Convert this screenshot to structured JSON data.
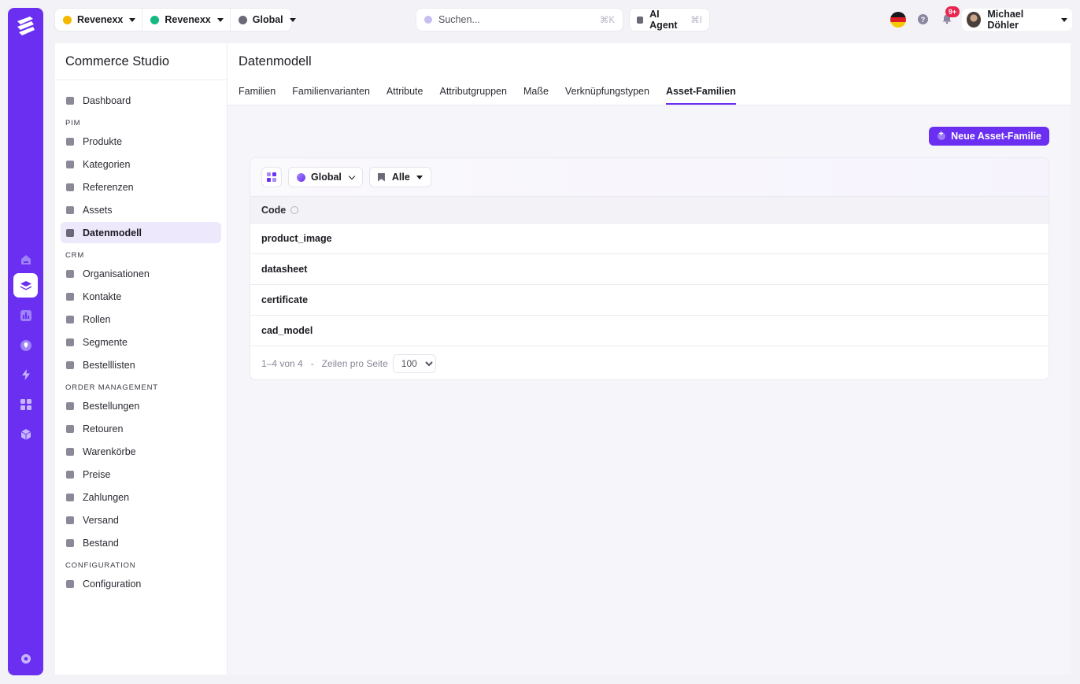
{
  "topbar": {
    "scopes": [
      {
        "label": "Revenexx",
        "dot_color": "#f5b800"
      },
      {
        "label": "Revenexx",
        "dot_color": "#13b981"
      },
      {
        "label": "Global",
        "dot_color": "#6b6877"
      }
    ],
    "search_placeholder": "Suchen...",
    "search_shortcut": "⌘K",
    "ai_agent_label": "AI Agent",
    "ai_agent_shortcut": "⌘I",
    "help_label": "?",
    "notification_badge": "9+",
    "user_name": "Michael Döhler"
  },
  "sidebar": {
    "title": "Commerce Studio",
    "sections": [
      {
        "heading": "",
        "items": [
          {
            "label": "Dashboard",
            "active": false
          }
        ]
      },
      {
        "heading": "PIM",
        "items": [
          {
            "label": "Produkte",
            "active": false
          },
          {
            "label": "Kategorien",
            "active": false
          },
          {
            "label": "Referenzen",
            "active": false
          },
          {
            "label": "Assets",
            "active": false
          },
          {
            "label": "Datenmodell",
            "active": true
          }
        ]
      },
      {
        "heading": "CRM",
        "items": [
          {
            "label": "Organisationen",
            "active": false
          },
          {
            "label": "Kontakte",
            "active": false
          },
          {
            "label": "Rollen",
            "active": false
          },
          {
            "label": "Segmente",
            "active": false
          },
          {
            "label": "Bestelllisten",
            "active": false
          }
        ]
      },
      {
        "heading": "ORDER MANAGEMENT",
        "items": [
          {
            "label": "Bestellungen",
            "active": false
          },
          {
            "label": "Retouren",
            "active": false
          },
          {
            "label": "Warenkörbe",
            "active": false
          },
          {
            "label": "Preise",
            "active": false
          },
          {
            "label": "Zahlungen",
            "active": false
          },
          {
            "label": "Versand",
            "active": false
          },
          {
            "label": "Bestand",
            "active": false
          }
        ]
      },
      {
        "heading": "CONFIGURATION",
        "items": [
          {
            "label": "Configuration",
            "active": false
          }
        ]
      }
    ]
  },
  "main": {
    "title": "Datenmodell",
    "tabs": [
      {
        "label": "Familien",
        "active": false
      },
      {
        "label": "Familienvarianten",
        "active": false
      },
      {
        "label": "Attribute",
        "active": false
      },
      {
        "label": "Attributgruppen",
        "active": false
      },
      {
        "label": "Maße",
        "active": false
      },
      {
        "label": "Verknüpfungstypen",
        "active": false
      },
      {
        "label": "Asset-Familien",
        "active": true
      }
    ],
    "new_button_label": "Neue Asset-Familie",
    "filters": {
      "scope_label": "Global",
      "view_label": "Alle"
    },
    "table": {
      "column_header": "Code",
      "rows": [
        "product_image",
        "datasheet",
        "certificate",
        "cad_model"
      ]
    },
    "pagination": {
      "range": "1–4 von 4",
      "separator": "-",
      "rows_per_page_label": "Zeilen pro Seite",
      "rows_per_page_value": "100"
    }
  },
  "colors": {
    "accent": "#6a2ff0",
    "badge": "#e8264f"
  }
}
